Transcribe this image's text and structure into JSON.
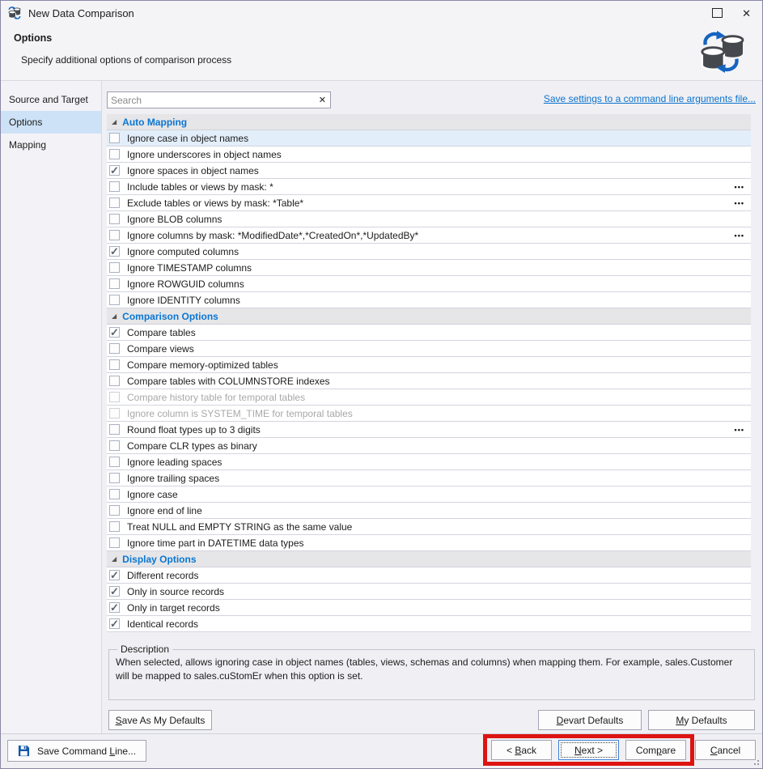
{
  "window": {
    "title": "New Data Comparison"
  },
  "header": {
    "title": "Options",
    "subtitle": "Specify additional options of comparison process"
  },
  "sidebar": {
    "items": [
      {
        "label": "Source and Target",
        "selected": false
      },
      {
        "label": "Options",
        "selected": true
      },
      {
        "label": "Mapping",
        "selected": false
      }
    ]
  },
  "search": {
    "placeholder": "Search"
  },
  "command_link": {
    "label": "Save settings to a command line arguments file..."
  },
  "icons": {
    "app_icon": "database-sync-icon",
    "header_icon": "database-sync-icon",
    "save_icon": "floppy-disk-icon",
    "close_glyph": "✕",
    "clear_glyph": "✕",
    "check_glyph": "✓",
    "triangle_glyph": "◢",
    "ellipsis_glyph": "•••"
  },
  "sections": [
    {
      "title": "Auto Mapping",
      "rows": [
        {
          "label": "Ignore case in object names",
          "checked": false,
          "selected": true
        },
        {
          "label": "Ignore underscores in object names",
          "checked": false
        },
        {
          "label": "Ignore spaces in object names",
          "checked": true
        },
        {
          "label": "Include tables or views by mask: *",
          "checked": false,
          "ellipsis": true
        },
        {
          "label": "Exclude tables or views by mask: *Table*",
          "checked": false,
          "ellipsis": true
        },
        {
          "label": "Ignore BLOB columns",
          "checked": false
        },
        {
          "label": "Ignore columns by mask: *ModifiedDate*,*CreatedOn*,*UpdatedBy*",
          "checked": false,
          "ellipsis": true
        },
        {
          "label": "Ignore computed columns",
          "checked": true
        },
        {
          "label": "Ignore TIMESTAMP columns",
          "checked": false
        },
        {
          "label": "Ignore ROWGUID columns",
          "checked": false
        },
        {
          "label": "Ignore IDENTITY columns",
          "checked": false
        }
      ]
    },
    {
      "title": "Comparison Options",
      "rows": [
        {
          "label": "Compare tables",
          "checked": true
        },
        {
          "label": "Compare views",
          "checked": false
        },
        {
          "label": "Compare memory-optimized tables",
          "checked": false
        },
        {
          "label": "Compare tables with COLUMNSTORE indexes",
          "checked": false
        },
        {
          "label": "Compare history table for temporal tables",
          "checked": false,
          "disabled": true
        },
        {
          "label": "Ignore column is SYSTEM_TIME for temporal tables",
          "checked": false,
          "disabled": true
        },
        {
          "label": "Round float types up to 3 digits",
          "checked": false,
          "ellipsis": true
        },
        {
          "label": "Compare CLR types as binary",
          "checked": false
        },
        {
          "label": "Ignore leading spaces",
          "checked": false
        },
        {
          "label": "Ignore trailing spaces",
          "checked": false
        },
        {
          "label": "Ignore case",
          "checked": false
        },
        {
          "label": "Ignore end of line",
          "checked": false
        },
        {
          "label": "Treat NULL and EMPTY STRING as the same value",
          "checked": false
        },
        {
          "label": "Ignore time part in DATETIME data types",
          "checked": false
        }
      ]
    },
    {
      "title": "Display Options",
      "rows": [
        {
          "label": "Different records",
          "checked": true
        },
        {
          "label": "Only in source records",
          "checked": true
        },
        {
          "label": "Only in target records",
          "checked": true
        },
        {
          "label": "Identical records",
          "checked": true
        }
      ]
    }
  ],
  "description": {
    "legend": "Description",
    "text": "When selected, allows ignoring case in object names (tables, views, schemas and columns) when mapping them. For example, sales.Customer will be mapped to sales.cuStomEr when this option is set."
  },
  "defaults": {
    "save_as": {
      "pre": "",
      "accel": "S",
      "post": "ave As My Defaults"
    },
    "devart": {
      "pre": "",
      "accel": "D",
      "post": "evart Defaults"
    },
    "my": {
      "pre": "",
      "accel": "M",
      "post": "y Defaults"
    }
  },
  "footer": {
    "save_command_line": {
      "pre": "Save Command ",
      "accel": "L",
      "post": "ine..."
    },
    "back": {
      "pre": "< ",
      "accel": "B",
      "post": "ack"
    },
    "next": {
      "pre": "",
      "accel": "N",
      "post": "ext >"
    },
    "compare": {
      "pre": "Com",
      "accel": "p",
      "post": "are"
    },
    "cancel": {
      "pre": "",
      "accel": "C",
      "post": "ancel"
    }
  },
  "colors": {
    "accent_blue": "#0b76d1",
    "link_blue": "#0a72ce",
    "annotation_red": "#dd1412",
    "selected_row": "#e3eefb",
    "sidebar_selected": "#cde2f6"
  }
}
